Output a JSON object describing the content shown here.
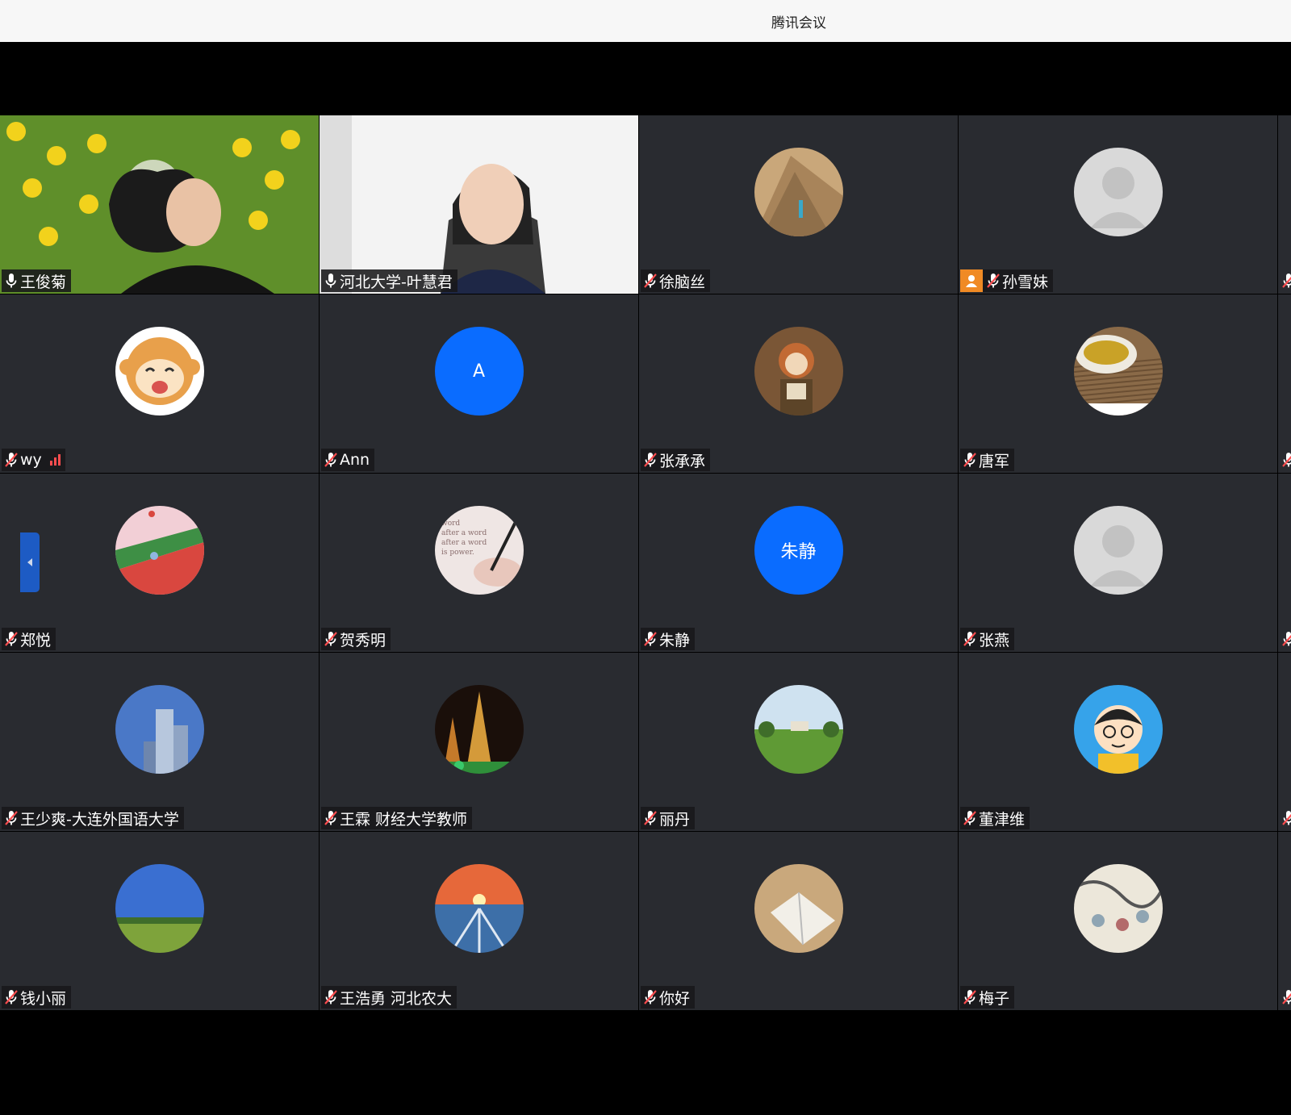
{
  "window": {
    "title": "腾讯会议"
  },
  "colors": {
    "tile_bg": "#292b30",
    "active_border": "#2dbb7a",
    "blue_avatar": "#0a6cff",
    "host_badge": "#f08a24",
    "muted_red": "#ff4d4f"
  },
  "participants": [
    {
      "name": "王俊菊",
      "mic": "on",
      "avatar": "video-camera-feed"
    },
    {
      "name": "河北大学-叶慧君",
      "mic": "on",
      "avatar": "video-camera-feed",
      "active": true
    },
    {
      "name": "徐脑丝",
      "mic": "muted",
      "avatar": "pyramid-photo"
    },
    {
      "name": "孙雪妹",
      "mic": "muted",
      "avatar": "default-person",
      "host": true
    },
    {
      "name": "wy",
      "mic": "muted",
      "avatar": "cartoon-monkey",
      "signal": "weak"
    },
    {
      "name": "Ann",
      "mic": "muted",
      "avatar": "initial",
      "initial": "A"
    },
    {
      "name": "张承承",
      "mic": "muted",
      "avatar": "illustrated-woman"
    },
    {
      "name": "唐军",
      "mic": "muted",
      "avatar": "tea-cup"
    },
    {
      "name": "郑悦",
      "mic": "muted",
      "avatar": "flower-field"
    },
    {
      "name": "贺秀明",
      "mic": "muted",
      "avatar": "writing-hand"
    },
    {
      "name": "朱静",
      "mic": "muted",
      "avatar": "initial",
      "initial": "朱静"
    },
    {
      "name": "张燕",
      "mic": "muted",
      "avatar": "default-person"
    },
    {
      "name": "王少爽-大连外国语大学",
      "mic": "muted",
      "avatar": "skyscraper"
    },
    {
      "name": "王霖 财经大学教师",
      "mic": "muted",
      "avatar": "pagoda-night"
    },
    {
      "name": "丽丹",
      "mic": "muted",
      "avatar": "campus-lawn"
    },
    {
      "name": "董津维",
      "mic": "muted",
      "avatar": "cartoon-boy"
    },
    {
      "name": "钱小丽",
      "mic": "muted",
      "avatar": "grassland"
    },
    {
      "name": "王浩勇 河北农大",
      "mic": "muted",
      "avatar": "sunset-terminal"
    },
    {
      "name": "你好",
      "mic": "muted",
      "avatar": "open-book"
    },
    {
      "name": "梅子",
      "mic": "muted",
      "avatar": "ink-painting"
    }
  ]
}
